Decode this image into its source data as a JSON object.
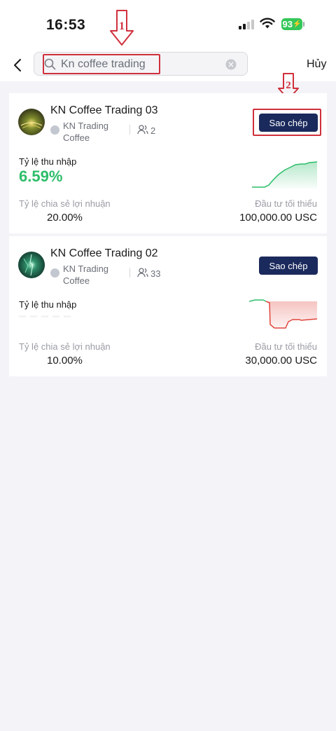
{
  "status_bar": {
    "time": "16:53",
    "battery": "93"
  },
  "search": {
    "value": "Kn coffee trading",
    "cancel_label": "Hủy"
  },
  "annotations": {
    "arrow1_label": "1",
    "arrow2_label": "2",
    "highlight_color": "#d0303c"
  },
  "results": [
    {
      "title": "KN Coffee Trading 03",
      "owner": "KN Trading Coffee",
      "followers": "2",
      "copy_label": "Sao chép",
      "rate_label": "Tỷ lệ thu nhập",
      "rate_value": "6.59%",
      "share_label": "Tỷ lệ chia sẻ lợi nhuận",
      "share_value": "20.00%",
      "min_label": "Đầu tư tối thiểu",
      "min_value": "100,000.00 USC",
      "trend": "up",
      "trend_color": "#2dbd6a"
    },
    {
      "title": "KN Coffee Trading 02",
      "owner": "KN Trading Coffee",
      "followers": "33",
      "copy_label": "Sao chép",
      "rate_label": "Tỷ lệ thu nhập",
      "rate_value": "",
      "share_label": "Tỷ lệ chia sẻ lợi nhuận",
      "share_value": "10.00%",
      "min_label": "Đầu tư tối thiểu",
      "min_value": "30,000.00 USC",
      "trend": "down",
      "trend_color": "#e0453c"
    }
  ],
  "colors": {
    "primary_button": "#1b2a5c",
    "positive": "#2dbd6a",
    "negative": "#e0453c"
  }
}
